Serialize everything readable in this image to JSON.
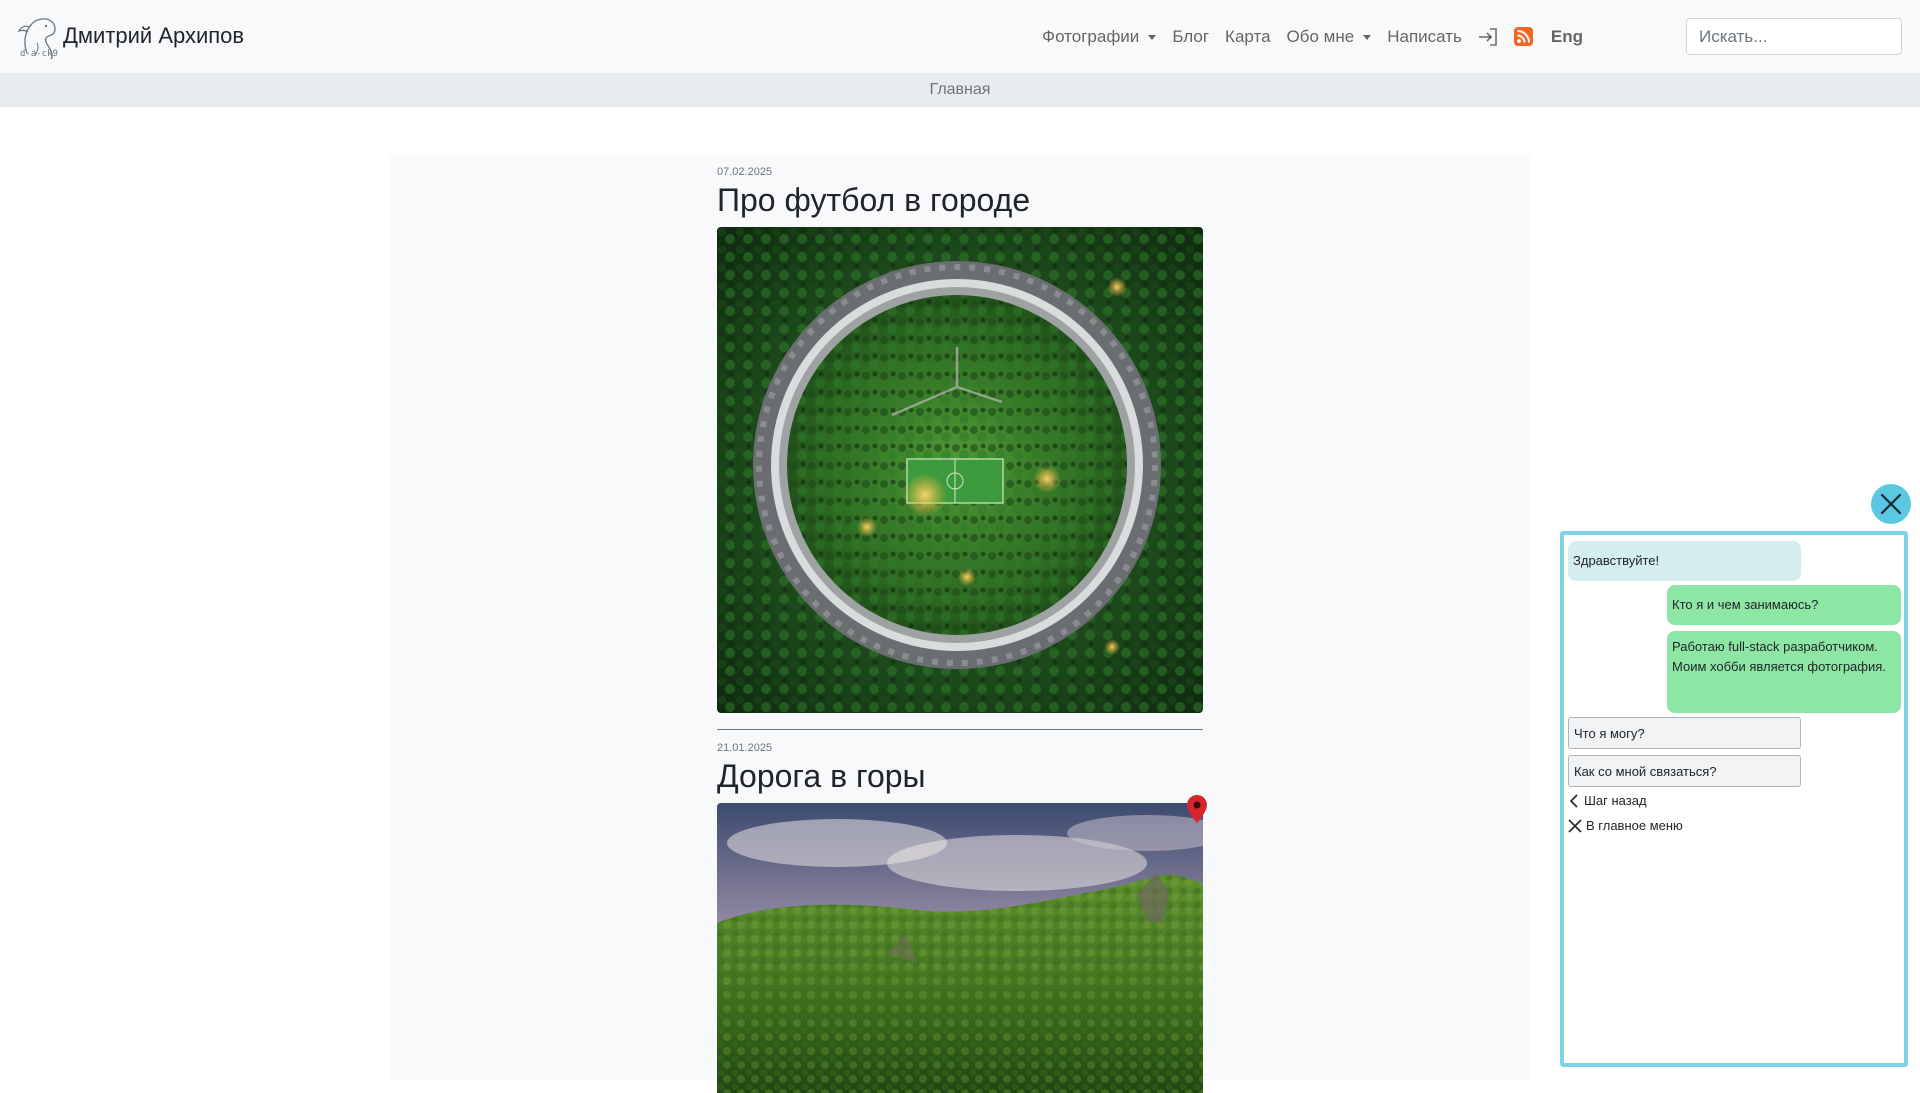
{
  "brand": {
    "logo_text": "d-a-ck9",
    "name": "Дмитрий Архипов"
  },
  "nav": {
    "photos": "Фотографии",
    "blog": "Блог",
    "map": "Карта",
    "about": "Обо мне",
    "write": "Написать",
    "login_icon": "login-icon",
    "rss_icon": "rss-icon",
    "lang": "Eng"
  },
  "search": {
    "placeholder": "Искать...",
    "value": ""
  },
  "breadcrumb": {
    "current": "Главная"
  },
  "posts": [
    {
      "date": "07.02.2025",
      "title": "Про футбол в городе",
      "image": "aerial-round-building-photo"
    },
    {
      "date": "21.01.2025",
      "title": "Дорога в горы",
      "image": "forest-mountain-photo",
      "has_map_pin": true
    }
  ],
  "chat": {
    "close_icon": "close-icon",
    "greeting": "Здравствуйте!",
    "user_question": "Кто я и чем занимаюсь?",
    "answer": "Работаю full-stack разработчиком. Моим хобби является фотография.",
    "options": [
      "Что я могу?",
      "Как со мной связаться?"
    ],
    "back": "Шаг назад",
    "main_menu": "В главное меню"
  },
  "colors": {
    "navbar_bg": "#f8f9fa",
    "breadcrumb_bg": "#e9ecef",
    "chat_border": "#7fd3e6",
    "chat_close_bg": "#5bc8e3",
    "bot_bubble": "#d4eef0",
    "user_bubble": "#8ee6a5",
    "rss": "#f26522",
    "map_pin": "#d9252c"
  }
}
